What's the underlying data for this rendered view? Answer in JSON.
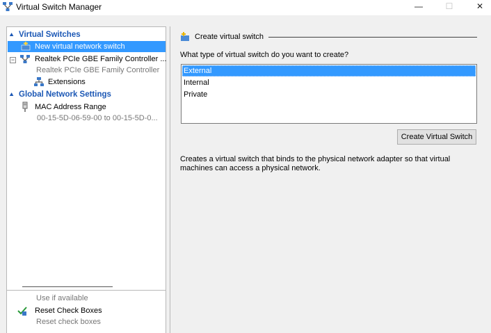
{
  "window": {
    "title": "Virtual Switch Manager",
    "minimize": "—",
    "maximize": "☐",
    "close": "✕"
  },
  "left_pane": {
    "virtual_switches_header": "Virtual Switches",
    "new_switch": "New virtual network switch",
    "realtek": {
      "label": "Realtek PCIe GBE Family Controller ...",
      "sub": "Realtek PCIe GBE Family Controller",
      "extensions": "Extensions"
    },
    "global_header": "Global Network Settings",
    "mac": {
      "label": "MAC Address Range",
      "sub": "00-15-5D-06-59-00 to 00-15-5D-0..."
    },
    "enhanced_session_sub": "Use if available",
    "reset": {
      "label": "Reset Check Boxes",
      "sub": "Reset check boxes"
    }
  },
  "right_pane": {
    "group_title": "Create virtual switch",
    "question": "What type of virtual switch do you want to create?",
    "options": [
      "External",
      "Internal",
      "Private"
    ],
    "selected_option": "External",
    "create_button": "Create Virtual Switch",
    "description": "Creates a virtual switch that binds to the physical network adapter so that virtual machines can access a physical network."
  },
  "colors": {
    "selection": "#3399ff",
    "header_text": "#1c58b5",
    "muted_text": "#777777"
  },
  "icons": [
    "switch-manager-icon",
    "chevron-up-icon",
    "new-switch-icon",
    "network-adapter-icon",
    "extensions-icon",
    "mac-address-icon",
    "reset-check-icon",
    "create-switch-icon"
  ]
}
